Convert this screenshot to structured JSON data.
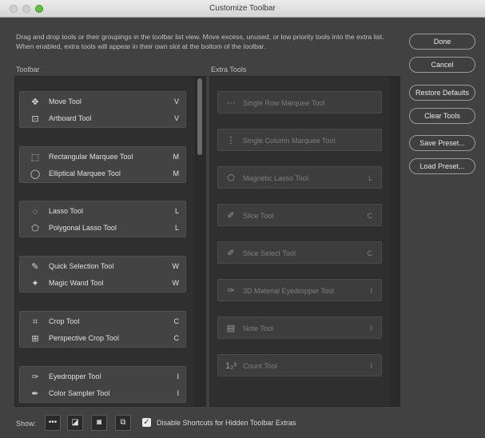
{
  "window": {
    "title": "Customize Toolbar"
  },
  "description": "Drag and drop tools or their groupings in the toolbar list view. Move excess, unused, or low priority tools into the extra list. When enabled, extra tools will appear in their own slot at the bottom of the toolbar.",
  "buttons": {
    "done": "Done",
    "cancel": "Cancel",
    "restore_defaults": "Restore Defaults",
    "clear_tools": "Clear Tools",
    "save_preset": "Save Preset...",
    "load_preset": "Load Preset..."
  },
  "toolbar": {
    "label": "Toolbar",
    "groups": [
      {
        "tools": [
          {
            "icon": "move-icon",
            "name": "Move Tool",
            "key": "V"
          },
          {
            "icon": "artboard-icon",
            "name": "Artboard Tool",
            "key": "V"
          }
        ]
      },
      {
        "tools": [
          {
            "icon": "rectangular-marquee-icon",
            "name": "Rectangular Marquee Tool",
            "key": "M"
          },
          {
            "icon": "elliptical-marquee-icon",
            "name": "Elliptical Marquee Tool",
            "key": "M"
          }
        ]
      },
      {
        "tools": [
          {
            "icon": "lasso-icon",
            "name": "Lasso Tool",
            "key": "L"
          },
          {
            "icon": "polygonal-lasso-icon",
            "name": "Polygonal Lasso Tool",
            "key": "L"
          }
        ]
      },
      {
        "tools": [
          {
            "icon": "quick-selection-icon",
            "name": "Quick Selection Tool",
            "key": "W"
          },
          {
            "icon": "magic-wand-icon",
            "name": "Magic Wand Tool",
            "key": "W"
          }
        ]
      },
      {
        "tools": [
          {
            "icon": "crop-icon",
            "name": "Crop Tool",
            "key": "C"
          },
          {
            "icon": "perspective-crop-icon",
            "name": "Perspective Crop Tool",
            "key": "C"
          }
        ]
      },
      {
        "tools": [
          {
            "icon": "eyedropper-icon",
            "name": "Eyedropper Tool",
            "key": "I"
          },
          {
            "icon": "color-sampler-icon",
            "name": "Color Sampler Tool",
            "key": "I"
          }
        ]
      }
    ]
  },
  "extra_tools": {
    "label": "Extra Tools",
    "items": [
      {
        "icon": "single-row-marquee-icon",
        "name": "Single Row Marquee Tool",
        "key": ""
      },
      {
        "icon": "single-column-marquee-icon",
        "name": "Single Column Marquee Tool",
        "key": ""
      },
      {
        "icon": "magnetic-lasso-icon",
        "name": "Magnetic Lasso Tool",
        "key": "L"
      },
      {
        "icon": "slice-icon",
        "name": "Slice Tool",
        "key": "C"
      },
      {
        "icon": "slice-select-icon",
        "name": "Slice Select Tool",
        "key": "C"
      },
      {
        "icon": "3d-material-eyedropper-icon",
        "name": "3D Material Eyedropper Tool",
        "key": "I"
      },
      {
        "icon": "note-icon",
        "name": "Note Tool",
        "key": "I"
      },
      {
        "icon": "count-icon",
        "name": "Count Tool",
        "key": "I"
      }
    ]
  },
  "bottom": {
    "show_label": "Show:",
    "show_buttons": [
      "more-icon",
      "foreground-background-icon",
      "quick-mask-icon",
      "screen-mode-icon"
    ],
    "checkbox_label": "Disable Shortcuts for Hidden Toolbar Extras",
    "checkbox_checked": true
  }
}
